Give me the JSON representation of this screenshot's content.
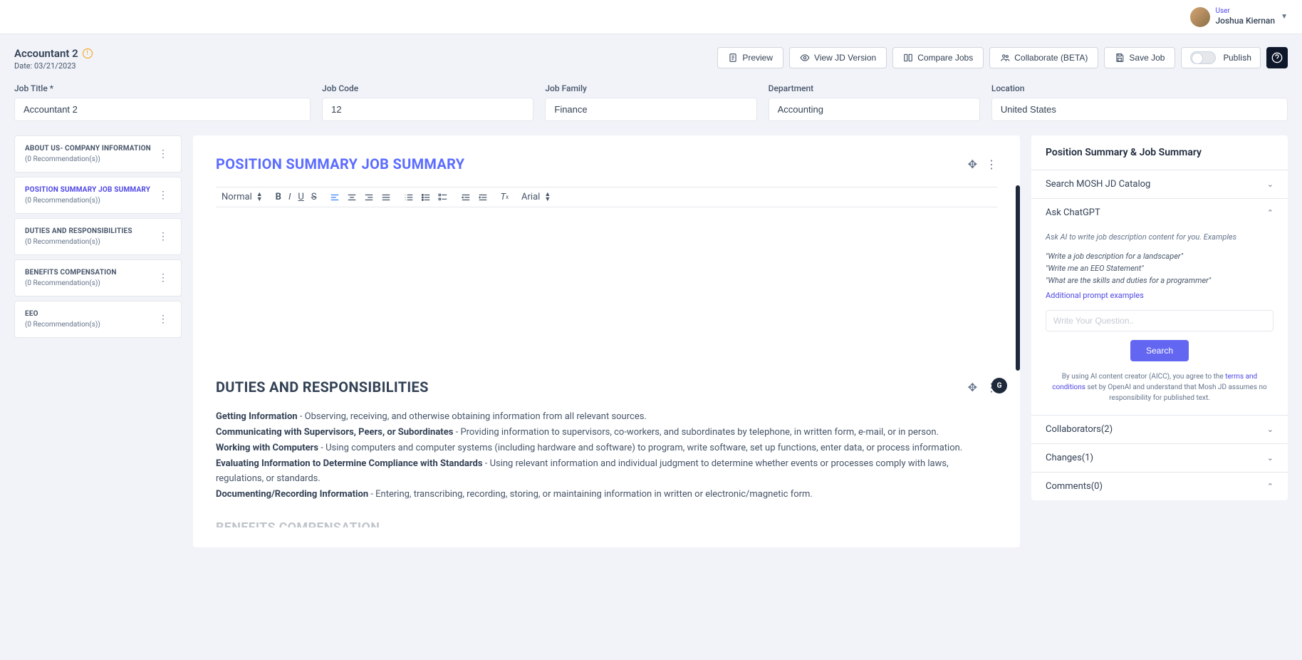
{
  "header": {
    "user_label": "User",
    "user_name": "Joshua Kiernan"
  },
  "page": {
    "title": "Accountant 2",
    "date_prefix": "Date: ",
    "date": "03/21/2023"
  },
  "actions": {
    "preview": "Preview",
    "view_jd": "View JD Version",
    "compare": "Compare Jobs",
    "collaborate": "Collaborate (BETA)",
    "save": "Save Job",
    "publish": "Publish"
  },
  "form": {
    "job_title": {
      "label": "Job Title *",
      "value": "Accountant 2"
    },
    "job_code": {
      "label": "Job Code",
      "value": "12"
    },
    "job_family": {
      "label": "Job Family",
      "value": "Finance"
    },
    "department": {
      "label": "Department",
      "value": "Accounting"
    },
    "location": {
      "label": "Location",
      "value": "United States"
    }
  },
  "sidebar": {
    "rec_text": "(0 Recommendation(s))",
    "items": [
      {
        "title": "ABOUT US- COMPANY INFORMATION"
      },
      {
        "title": "POSITION SUMMARY JOB SUMMARY"
      },
      {
        "title": "DUTIES AND RESPONSIBILITIES"
      },
      {
        "title": "BENEFITS COMPENSATION"
      },
      {
        "title": "EEO"
      }
    ]
  },
  "editor": {
    "section1_title": "POSITION SUMMARY JOB SUMMARY",
    "toolbar": {
      "normal": "Normal",
      "font": "Arial"
    },
    "section2_title": "DUTIES AND RESPONSIBILITIES",
    "duties": [
      {
        "b": "Getting Information",
        "t": " - Observing, receiving, and otherwise obtaining information from all relevant sources."
      },
      {
        "b": "Communicating with Supervisors, Peers, or Subordinates",
        "t": " - Providing information to supervisors, co-workers, and subordinates by telephone, in written form, e-mail, or in person."
      },
      {
        "b": "Working with Computers",
        "t": " - Using computers and computer systems (including hardware and software) to program, write software, set up functions, enter data, or process information."
      },
      {
        "b": "Evaluating Information to Determine Compliance with Standards",
        "t": " - Using relevant information and individual judgment to determine whether events or processes comply with laws, regulations, or standards."
      },
      {
        "b": "Documenting/Recording Information",
        "t": " - Entering, transcribing, recording, storing, or maintaining information in written or electronic/magnetic form."
      }
    ],
    "section3_title": "BENEFITS COMPENSATION"
  },
  "right": {
    "header": "Position Summary & Job Summary",
    "catalog": "Search MOSH JD Catalog",
    "ask": {
      "title": "Ask ChatGPT",
      "hint": "Ask AI to write job description content for you. Examples",
      "ex1": "\"Write a job description for a landscaper\"",
      "ex2": "\"Write me an EEO Statement\"",
      "ex3": "\"What are the skills and duties for a programmer\"",
      "link": "Additional prompt examples",
      "placeholder": "Write Your Question..",
      "button": "Search",
      "disclaimer_a": "By using AI content creator (AICC), you agree to the ",
      "disclaimer_link": "terms and conditions",
      "disclaimer_b": " set by OpenAI and understand that Mosh JD assumes no responsibility for published text."
    },
    "collaborators": "Collaborators(2)",
    "changes": "Changes(1)",
    "comments": "Comments(0)"
  }
}
